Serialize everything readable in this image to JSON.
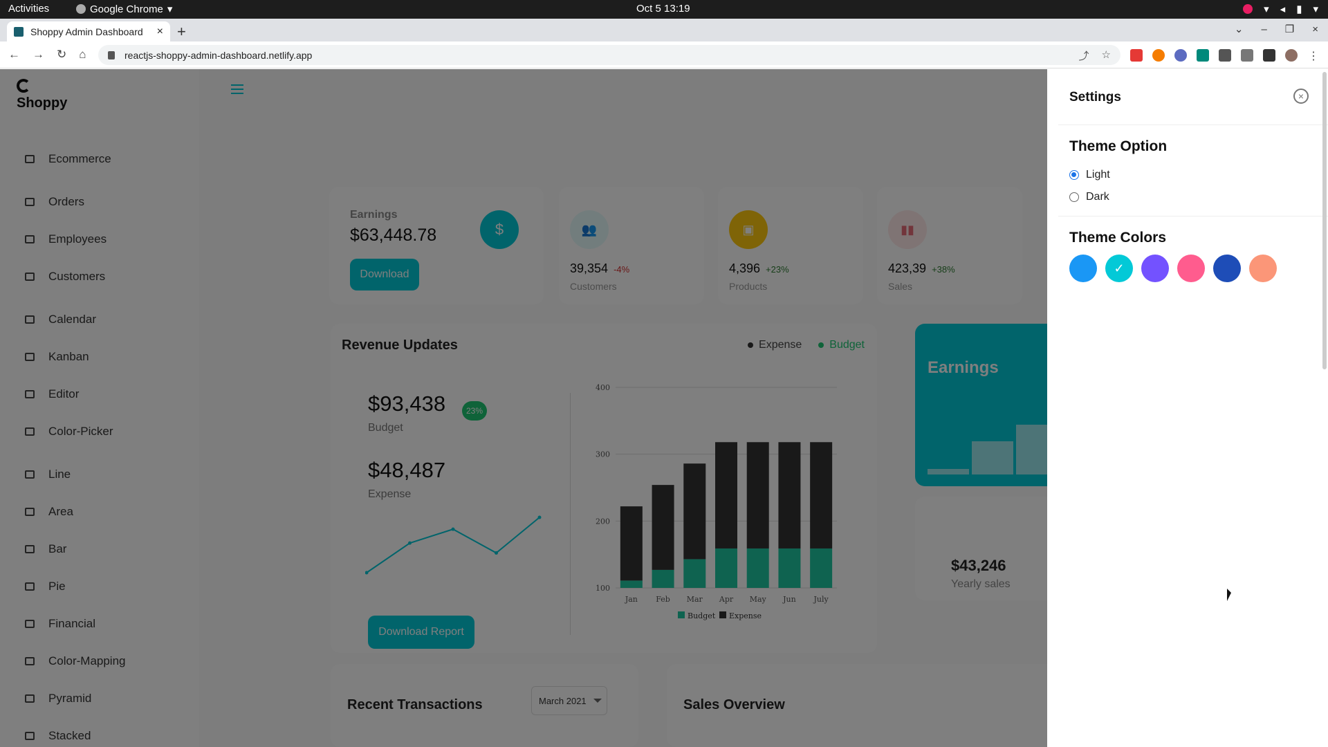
{
  "os": {
    "activities": "Activities",
    "app_name": "Google Chrome",
    "clock": "Oct 5  13:19"
  },
  "browser": {
    "tab_title": "Shoppy Admin Dashboard",
    "url": "reactjs-shoppy-admin-dashboard.netlify.app"
  },
  "sidebar": {
    "logo": "Shoppy",
    "items": [
      {
        "label": "Ecommerce"
      },
      {
        "label": "Orders"
      },
      {
        "label": "Employees"
      },
      {
        "label": "Customers"
      },
      {
        "label": "Calendar"
      },
      {
        "label": "Kanban"
      },
      {
        "label": "Editor"
      },
      {
        "label": "Color-Picker"
      },
      {
        "label": "Line"
      },
      {
        "label": "Area"
      },
      {
        "label": "Bar"
      },
      {
        "label": "Pie"
      },
      {
        "label": "Financial"
      },
      {
        "label": "Color-Mapping"
      },
      {
        "label": "Pyramid"
      },
      {
        "label": "Stacked"
      }
    ]
  },
  "earnings": {
    "label": "Earnings",
    "value": "$63,448.78",
    "icon": "$",
    "button": "Download"
  },
  "stats": [
    {
      "value": "39,354",
      "pct": "-4%",
      "pct_color": "#d32f2f",
      "caption": "Customers",
      "icon_bg": "#e5fafb",
      "icon_color": "#03c9d7"
    },
    {
      "value": "4,396",
      "pct": "+23%",
      "pct_color": "#2e7d32",
      "caption": "Products",
      "icon_bg": "#fff4e5",
      "icon_color": "#fec90f"
    },
    {
      "value": "423,39",
      "pct": "+38%",
      "pct_color": "#2e7d32",
      "caption": "Sales",
      "icon_bg": "#fff4e5",
      "icon_color": "#e46a76"
    }
  ],
  "revenue": {
    "title": "Revenue Updates",
    "legend_expense": "Expense",
    "legend_budget": "Budget",
    "budget_value": "$93,438",
    "budget_label": "Budget",
    "budget_badge": "23%",
    "expense_value": "$48,487",
    "expense_label": "Expense",
    "button": "Download Report"
  },
  "teal_card": {
    "title": "Earnings"
  },
  "yearly": {
    "value": "$43,246",
    "caption": "Yearly sales"
  },
  "recent": {
    "title": "Recent Transactions",
    "select": "March 2021"
  },
  "sales_overview": {
    "title": "Sales Overview"
  },
  "settings": {
    "title": "Settings",
    "theme_option": "Theme Option",
    "light": "Light",
    "dark": "Dark",
    "theme_colors": "Theme Colors",
    "colors": [
      "#1A97F5",
      "#03C9D7",
      "#7352FF",
      "#FF5C8E",
      "#1E4DB7",
      "#FB9678"
    ],
    "selected_color_index": 1
  },
  "chart_data": {
    "type": "bar",
    "stacked": true,
    "categories": [
      "Jan",
      "Feb",
      "Mar",
      "Apr",
      "May",
      "Jun",
      "July"
    ],
    "series": [
      {
        "name": "Budget",
        "values": [
          111,
          127,
          143,
          159,
          159,
          159,
          159
        ]
      },
      {
        "name": "Expense",
        "values": [
          111,
          127,
          143,
          159,
          159,
          159,
          159
        ]
      }
    ],
    "ylim": [
      100,
      400
    ],
    "yticks": [
      100,
      200,
      300,
      400
    ],
    "legend": "bottom"
  },
  "sparkline": {
    "values": [
      20,
      35,
      42,
      30,
      48
    ]
  }
}
